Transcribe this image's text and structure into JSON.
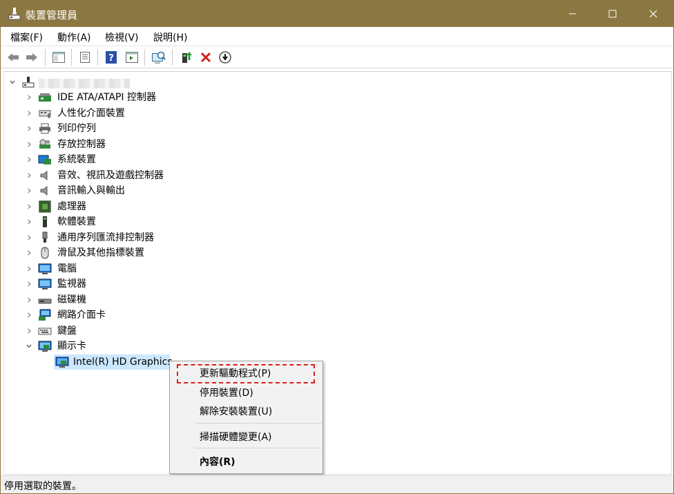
{
  "window": {
    "title": "裝置管理員",
    "controls": {
      "minimize": "─",
      "maximize": "☐",
      "close": "✕"
    }
  },
  "menubar": {
    "items": [
      {
        "label": "檔案(F)"
      },
      {
        "label": "動作(A)"
      },
      {
        "label": "檢視(V)"
      },
      {
        "label": "說明(H)"
      }
    ]
  },
  "toolbar": {
    "buttons": [
      "back-icon",
      "forward-icon",
      "show-hide-tree-icon",
      "properties-icon",
      "help-icon",
      "action-pane-icon",
      "scan-hardware-icon",
      "update-driver-icon",
      "uninstall-icon",
      "disable-icon"
    ]
  },
  "tree": {
    "root_label": "",
    "categories": [
      {
        "label": "IDE ATA/ATAPI 控制器",
        "icon": "ide-controller-icon"
      },
      {
        "label": "人性化介面裝置",
        "icon": "hid-icon"
      },
      {
        "label": "列印佇列",
        "icon": "printer-icon"
      },
      {
        "label": "存放控制器",
        "icon": "storage-controller-icon"
      },
      {
        "label": "系統裝置",
        "icon": "system-device-icon"
      },
      {
        "label": "音效、視訊及遊戲控制器",
        "icon": "speaker-icon"
      },
      {
        "label": "音訊輸入與輸出",
        "icon": "speaker-icon"
      },
      {
        "label": "處理器",
        "icon": "processor-icon"
      },
      {
        "label": "軟體裝置",
        "icon": "software-device-icon"
      },
      {
        "label": "通用序列匯流排控制器",
        "icon": "usb-icon"
      },
      {
        "label": "滑鼠及其他指標裝置",
        "icon": "mouse-icon"
      },
      {
        "label": "電腦",
        "icon": "computer-icon"
      },
      {
        "label": "監視器",
        "icon": "monitor-icon"
      },
      {
        "label": "磁碟機",
        "icon": "disk-drive-icon"
      },
      {
        "label": "網路介面卡",
        "icon": "network-adapter-icon"
      },
      {
        "label": "鍵盤",
        "icon": "keyboard-icon"
      },
      {
        "label": "顯示卡",
        "icon": "display-adapter-icon"
      }
    ],
    "selected_child": {
      "label": "Intel(R) HD Graphics",
      "icon": "display-adapter-icon"
    }
  },
  "context_menu": {
    "update_driver": "更新驅動程式(P)",
    "disable_device": "停用裝置(D)",
    "uninstall_device": "解除安裝裝置(U)",
    "scan_hardware": "掃描硬體變更(A)",
    "properties": "內容(R)"
  },
  "statusbar": {
    "text": "停用選取的裝置。"
  },
  "colors": {
    "titlebar": "#8b7741",
    "selection": "#cce8ff",
    "highlight_dash": "#d81e1e",
    "menu_bg": "#f2f2f2"
  }
}
